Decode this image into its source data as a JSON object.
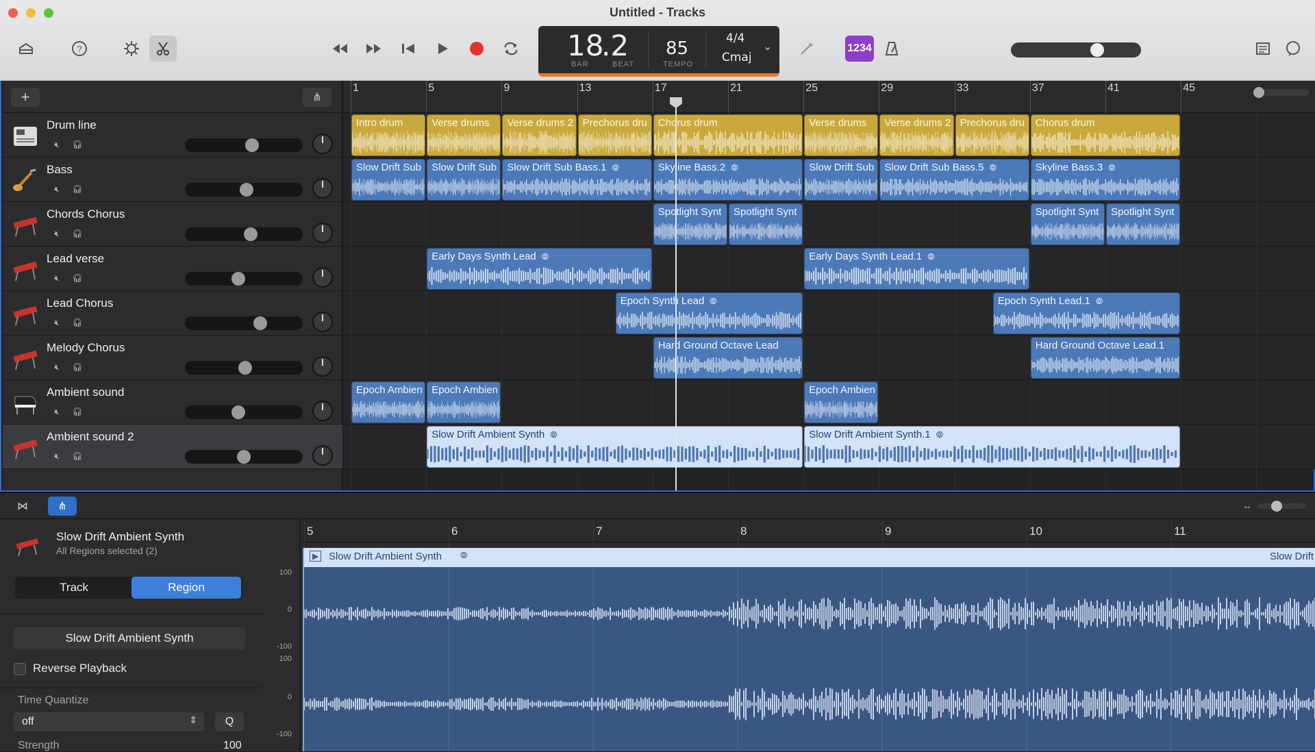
{
  "window": {
    "title": "Untitled - Tracks"
  },
  "lcd": {
    "bar": "18",
    "beat": ".2",
    "bar_caption": "BAR",
    "beat_caption": "BEAT",
    "tempo": "85",
    "tempo_caption": "TEMPO",
    "signature": "4/4",
    "key": "Cmaj"
  },
  "count_in": "1234",
  "ruler": {
    "bars": [
      "1",
      "5",
      "9",
      "13",
      "17",
      "21",
      "25",
      "29",
      "33",
      "37",
      "41",
      "45"
    ]
  },
  "tracks": [
    {
      "name": "Drum line",
      "icon": "drum-machine-icon"
    },
    {
      "name": "Bass",
      "icon": "bass-guitar-icon"
    },
    {
      "name": "Chords Chorus",
      "icon": "synth-keyboard-icon"
    },
    {
      "name": "Lead verse",
      "icon": "synth-keyboard-icon"
    },
    {
      "name": "Lead Chorus",
      "icon": "synth-keyboard-icon"
    },
    {
      "name": "Melody Chorus",
      "icon": "synth-keyboard-icon"
    },
    {
      "name": "Ambient sound",
      "icon": "grand-piano-icon"
    },
    {
      "name": "Ambient sound 2",
      "icon": "synth-keyboard-icon"
    }
  ],
  "regions": {
    "drum": [
      "Intro drum",
      "Verse drums",
      "Verse drums 2",
      "Prechorus dru",
      "Chorus drum",
      "Verse drums",
      "Verse drums 2",
      "Prechorus dru",
      "Chorus drum"
    ],
    "bass": [
      "Slow Drift Sub",
      "Slow Drift Sub",
      "Slow Drift Sub Bass.1",
      "Skyline Bass.2",
      "Slow Drift Sub",
      "Slow Drift Sub Bass.5",
      "Skyline Bass.3"
    ],
    "chords": [
      "Spotlight Synt",
      "Spotlight Synt",
      "Spotlight Synt",
      "Spotlight Synt"
    ],
    "lead_verse": [
      "Early Days Synth Lead",
      "Early Days Synth Lead.1"
    ],
    "lead_chorus": [
      "Epoch Synth Lead",
      "Epoch Synth Lead.1"
    ],
    "melody": [
      "Hard Ground Octave Lead",
      "Hard Ground Octave Lead.1"
    ],
    "ambient": [
      "Epoch Ambien",
      "Epoch Ambien",
      "Epoch Ambien"
    ],
    "ambient2": [
      "Slow Drift Ambient Synth",
      "Slow Drift Ambient Synth.1"
    ]
  },
  "editor": {
    "track_name": "Slow Drift Ambient Synth",
    "subtitle": "All Regions selected (2)",
    "tab_track": "Track",
    "tab_region": "Region",
    "region_name": "Slow Drift Ambient Synth",
    "reverse_label": "Reverse Playback",
    "quantize_label": "Time Quantize",
    "quantize_value": "off",
    "q_button": "Q",
    "strength_label": "Strength",
    "strength_value": "100",
    "bars": [
      "5",
      "6",
      "7",
      "8",
      "9",
      "10",
      "11"
    ],
    "region_label": "Slow Drift Ambient Synth",
    "region_label_right": "Slow Drift",
    "y_labels": [
      "100",
      "0",
      "-100",
      "100",
      "0",
      "-100"
    ]
  }
}
